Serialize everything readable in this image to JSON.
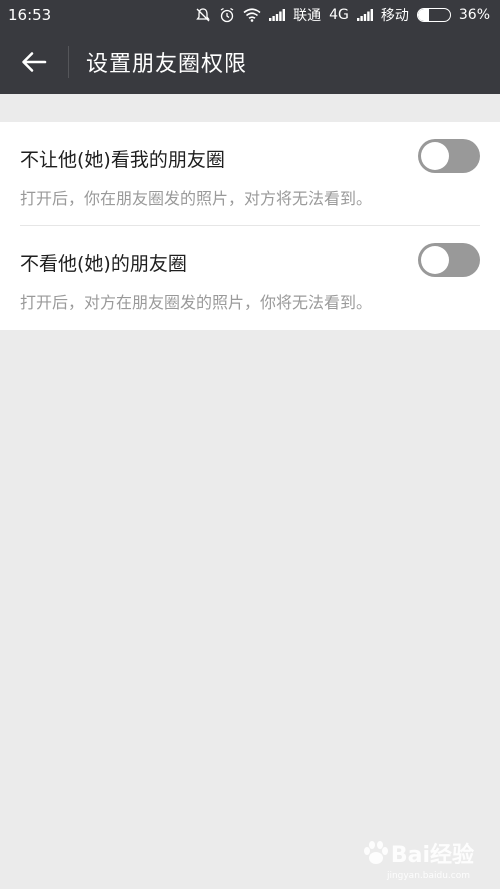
{
  "status_bar": {
    "time": "16:53",
    "carrier1": "联通",
    "network": "4G",
    "carrier2": "移动",
    "battery": "36%",
    "battery_level": 0.36
  },
  "header": {
    "title": "设置朋友圈权限"
  },
  "settings": [
    {
      "title": "不让他(她)看我的朋友圈",
      "description": "打开后，你在朋友圈发的照片，对方将无法看到。",
      "enabled": false
    },
    {
      "title": "不看他(她)的朋友圈",
      "description": "打开后，对方在朋友圈发的照片，你将无法看到。",
      "enabled": false
    }
  ],
  "watermark": {
    "text": "Bai经验",
    "sub": "jingyan.baidu.com"
  },
  "colors": {
    "header_bg": "#393a3f",
    "page_bg": "#ebebeb",
    "toggle_off": "#999999"
  },
  "icons": [
    "mute-icon",
    "alarm-icon",
    "wifi-icon",
    "signal-icon",
    "back-arrow-icon",
    "paw-icon"
  ]
}
